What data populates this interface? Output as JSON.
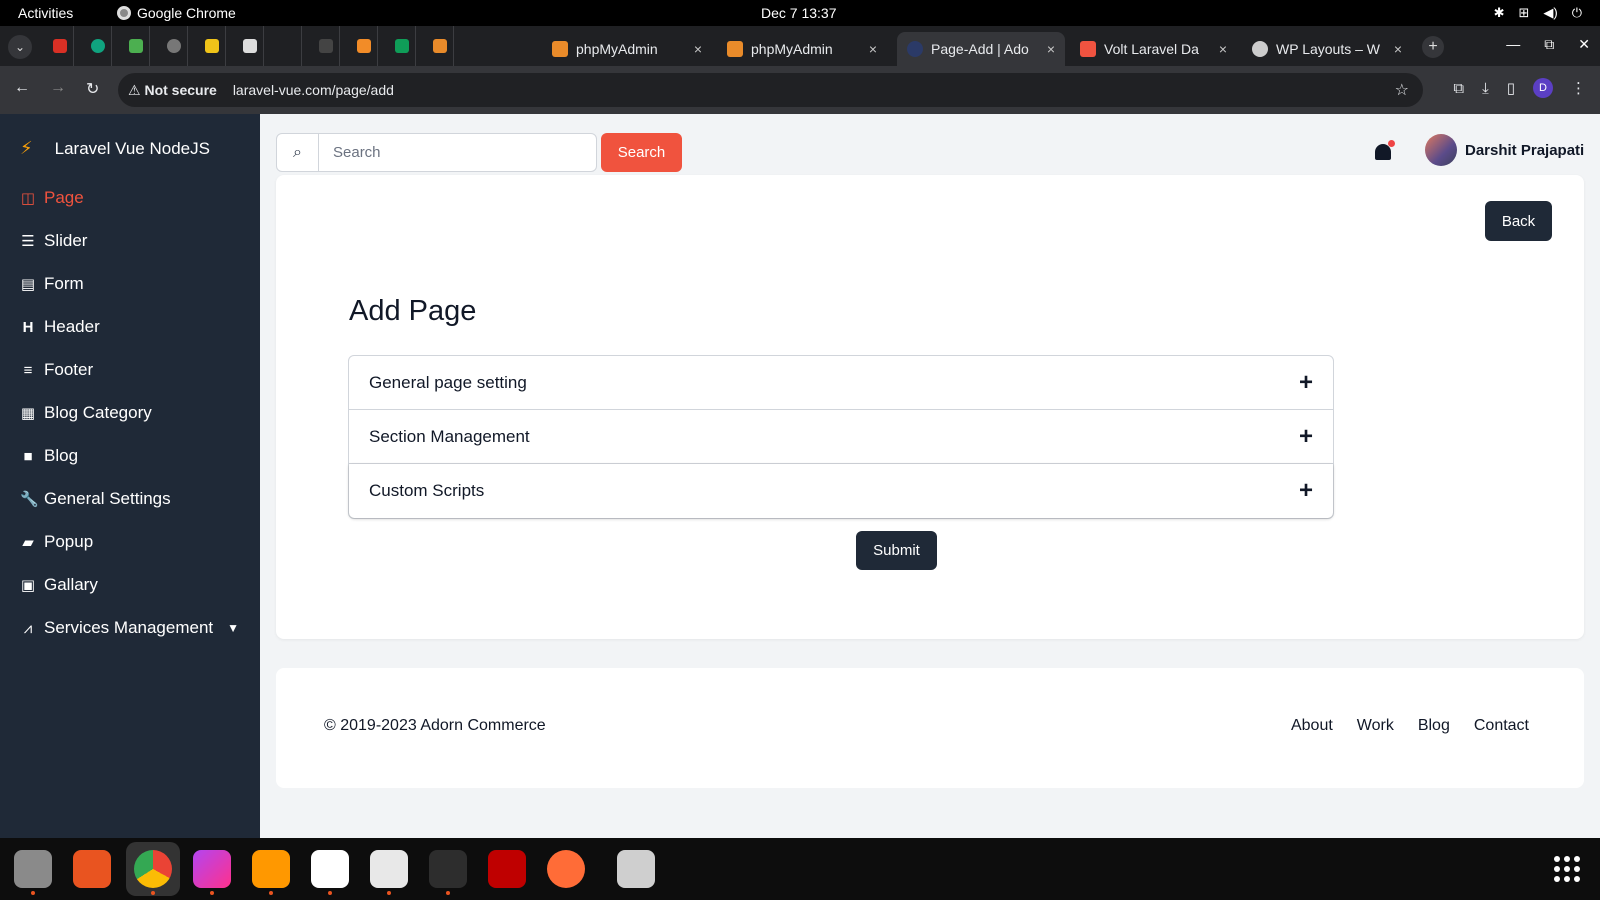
{
  "system_bar": {
    "activities": "Activities",
    "app_name": "Google Chrome",
    "clock": "Dec 7  13:37"
  },
  "browser": {
    "tabs": [
      {
        "title": "phpMyAdmin",
        "icon": "phpmyadmin-icon",
        "active": false
      },
      {
        "title": "phpMyAdmin",
        "icon": "phpmyadmin-icon",
        "active": false
      },
      {
        "title": "Page-Add | Ado",
        "icon": "adorn-icon",
        "active": true
      },
      {
        "title": "Volt Laravel Da",
        "icon": "volt-icon",
        "active": false
      },
      {
        "title": "WP Layouts – W",
        "icon": "wordpress-icon",
        "active": false
      }
    ],
    "close_glyph": "×",
    "security_label": "Not secure",
    "url": "laravel-vue.com/page/add",
    "profile_initial": "D"
  },
  "sidebar": {
    "brand": "Laravel Vue NodeJS",
    "items": [
      {
        "label": "Page",
        "icon": "columns-icon",
        "active": true
      },
      {
        "label": "Slider",
        "icon": "sliders-icon",
        "active": false
      },
      {
        "label": "Form",
        "icon": "file-icon",
        "active": false
      },
      {
        "label": "Header",
        "icon": "heading-icon",
        "active": false
      },
      {
        "label": "Footer",
        "icon": "bars-icon",
        "active": false
      },
      {
        "label": "Blog Category",
        "icon": "grid-icon",
        "active": false
      },
      {
        "label": "Blog",
        "icon": "square-icon",
        "active": false
      },
      {
        "label": "General Settings",
        "icon": "wrench-icon",
        "active": false
      },
      {
        "label": "Popup",
        "icon": "comment-icon",
        "active": false
      },
      {
        "label": "Gallary",
        "icon": "image-icon",
        "active": false
      },
      {
        "label": "Services Management",
        "icon": "laravel-icon",
        "active": false
      }
    ]
  },
  "header": {
    "search_placeholder": "Search",
    "search_button": "Search",
    "user_name": "Darshit Prajapati"
  },
  "main": {
    "back_button": "Back",
    "title": "Add Page",
    "sections": [
      {
        "label": "General page setting",
        "toggle": "+"
      },
      {
        "label": "Section Management",
        "toggle": "+"
      },
      {
        "label": "Custom Scripts",
        "toggle": "+"
      }
    ],
    "submit_button": "Submit"
  },
  "footer": {
    "copyright": "© 2019-2023 Adorn Commerce",
    "links": [
      "About",
      "Work",
      "Blog",
      "Contact"
    ]
  },
  "colors": {
    "accent": "#f0533e",
    "sidebar_bg": "#1f2937",
    "page_bg": "#f2f4f6"
  }
}
